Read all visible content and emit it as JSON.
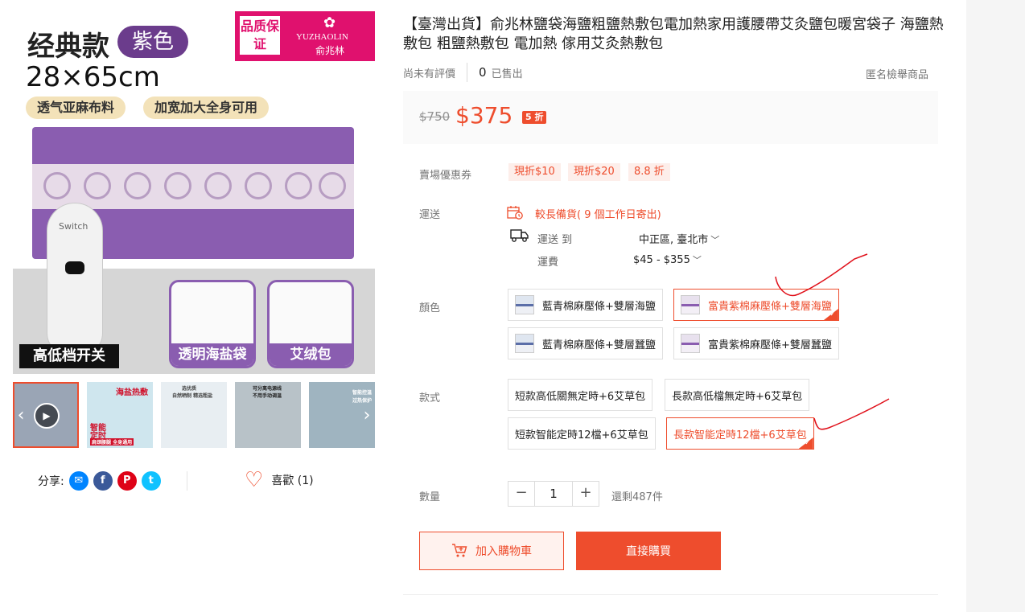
{
  "gallery": {
    "image_text": {
      "style": "经典款",
      "color_badge": "紫色",
      "size": "28×65cm",
      "tags": [
        "透气亚麻布料",
        "加宽加大全身可用"
      ],
      "brand_quality": "品质保证",
      "brand_en": "YUZHAOLIN",
      "brand_zh": "俞兆林",
      "switch_text": "Switch",
      "switch_label": "高低档开关",
      "cards": [
        "透明海盐袋",
        "艾绒包"
      ]
    },
    "thumbnails": [
      {
        "labels": []
      },
      {
        "labels": [
          "海盐热敷",
          "智能",
          "定时",
          "肩颈腰腿 全身通用"
        ]
      },
      {
        "labels": [
          "选优质",
          "自然晒制 精选粗盐"
        ]
      },
      {
        "labels": [
          "可分离电源线",
          "不用手动调温"
        ]
      },
      {
        "labels": [
          "智能控温",
          "过热保护"
        ]
      }
    ],
    "share_label": "分享:",
    "social_icons": [
      "messenger-icon",
      "facebook-icon",
      "pinterest-icon",
      "twitter-icon"
    ],
    "like_label": "喜歡 (1)"
  },
  "product": {
    "title": "【臺灣出貨】俞兆林鹽袋海鹽粗鹽熱敷包電加熱家用護腰帶艾灸鹽包暖宮袋子 海鹽熱敷包 粗鹽熱敷包 電加熱 傢用艾灸熱敷包",
    "rating_text": "尚未有評價",
    "sold_count": "0",
    "sold_label": "已售出",
    "report_link": "匿名檢舉商品",
    "price_original": "$750",
    "price_current": "$375",
    "discount_badge": "5 折",
    "voucher_label": "賣場優惠券",
    "vouchers": [
      "現折$10",
      "現折$20",
      "8.8 折"
    ],
    "shipping_label": "運送",
    "shipping_note": "較長備貨( 9 個工作日寄出)",
    "ship_to_label": "運送 到",
    "ship_to_value": "中正區, 臺北市",
    "ship_fee_label": "運費",
    "ship_fee_value": "$45 - $355",
    "color_label": "顏色",
    "colors": [
      "藍青棉麻壓條+雙層海鹽",
      "富貴紫棉麻壓條+雙層海鹽",
      "藍青棉麻壓條+雙層蠶鹽",
      "富貴紫棉麻壓條+雙層蠶鹽"
    ],
    "color_selected": "富貴紫棉麻壓條+雙層海鹽",
    "style_label": "款式",
    "styles": [
      "短款高低關無定時+6艾草包",
      "長款高低檔無定時+6艾草包",
      "短款智能定時12檔+6艾草包",
      "長款智能定時12檔+6艾草包"
    ],
    "style_selected": "長款智能定時12檔+6艾草包",
    "quantity_label": "數量",
    "quantity": "1",
    "stock_text": "還剩487件",
    "add_to_cart": "加入購物車",
    "buy_now": "直接購買"
  },
  "colors": {
    "accent": "#ee4d2d",
    "voucher_bg": "#fdeeea",
    "purple": "#8a5db0",
    "annotation": "#e0101a"
  }
}
